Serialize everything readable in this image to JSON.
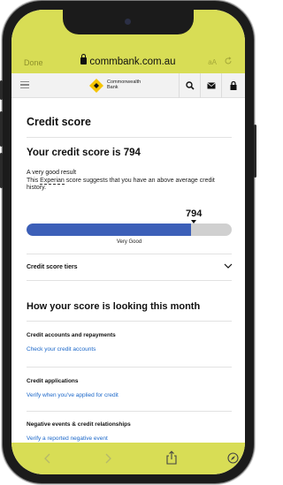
{
  "browser": {
    "done_label": "Done",
    "url": "commbank.com.au",
    "text_size_label": "aA",
    "reload_icon": "reload-icon"
  },
  "app_header": {
    "logo_line1": "Commonwealth",
    "logo_line2": "Bank",
    "icons": [
      "menu-icon",
      "search-icon",
      "mail-icon",
      "lock-icon"
    ]
  },
  "page": {
    "title": "Credit score",
    "score_heading": "Your credit score is 794",
    "result_label": "A very good result",
    "desc_prefix": "This ",
    "desc_link": "Experian",
    "desc_suffix": " score suggests that you have an above average credit history.",
    "score_value": "794",
    "score_fraction": 0.8,
    "score_band": "Very Good",
    "tiers_label": "Credit score tiers",
    "section_heading": "How your score is looking this month",
    "items": [
      {
        "title": "Credit accounts and repayments",
        "link": "Check your credit accounts"
      },
      {
        "title": "Credit applications",
        "link": "Verify when you've applied for credit"
      },
      {
        "title": "Negative events & credit relationships",
        "link": "Verify a reported negative event"
      }
    ]
  },
  "colors": {
    "browser_bar": "#d8dd55",
    "score_bar": "#3c5fb8",
    "link": "#1b67c9",
    "logo_yellow": "#f5c400"
  },
  "toolbar": {
    "icons": [
      "back-icon",
      "forward-icon",
      "share-icon",
      "compass-icon"
    ]
  }
}
